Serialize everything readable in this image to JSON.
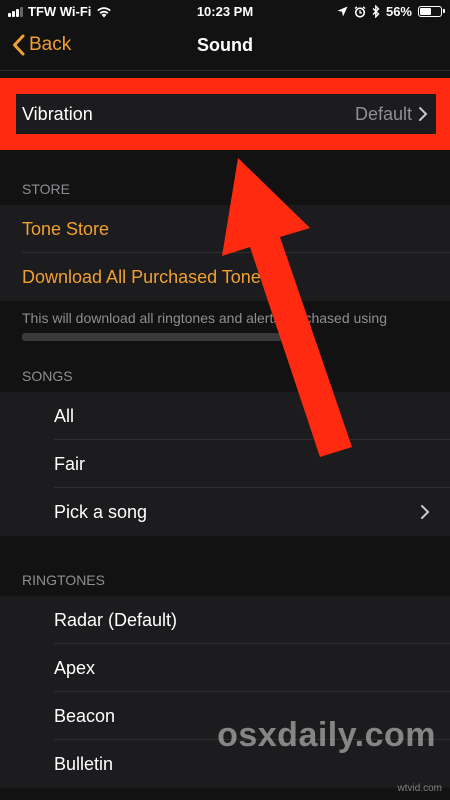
{
  "status_bar": {
    "carrier": "TFW Wi-Fi",
    "time": "10:23 PM",
    "battery": "56%",
    "battery_level": 0.56
  },
  "nav": {
    "back_label": "Back",
    "title": "Sound"
  },
  "vibration": {
    "label": "Vibration",
    "value": "Default"
  },
  "store": {
    "header": "STORE",
    "items": [
      "Tone Store",
      "Download All Purchased Tones"
    ],
    "footer": "This will download all ringtones and alerts purchased using"
  },
  "songs": {
    "header": "SONGS",
    "items": [
      "All",
      "Fair",
      "Pick a song"
    ]
  },
  "ringtones": {
    "header": "RINGTONES",
    "items": [
      "Radar (Default)",
      "Apex",
      "Beacon",
      "Bulletin"
    ]
  },
  "watermark": {
    "text": "osxdaily.com",
    "small": "wtvid.com"
  },
  "colors": {
    "accent": "#f0a030",
    "highlight": "#ff2a10"
  }
}
